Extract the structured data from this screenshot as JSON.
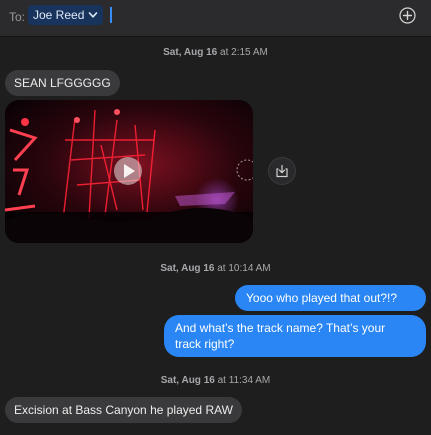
{
  "header": {
    "to_label": "To:",
    "recipient": "Joe Reed",
    "recipient_icon": "chevron-down-icon",
    "add_icon": "plus-circle-icon"
  },
  "messages": {
    "ts1": {
      "day": "Sat, Aug 16",
      "at": "at",
      "time": "2:15 AM"
    },
    "m1": "SEAN LFGGGGG",
    "video": {
      "play_icon": "play-icon",
      "save_icon": "save-download-icon"
    },
    "ts2": {
      "day": "Sat, Aug 16",
      "at": "at",
      "time": "10:14 AM"
    },
    "m2": "Yooo who played that out?!?",
    "m3_line1": "And what’s the track name? That’s your",
    "m3_line2": "track right?",
    "ts3": {
      "day": "Sat, Aug 16",
      "at": "at",
      "time": "11:34 AM"
    },
    "m4": "Excision at Bass Canyon he played RAW"
  },
  "colors": {
    "background": "#1e1e1e",
    "header": "#2b2b2d",
    "incoming_bubble": "#3a3a3c",
    "outgoing_bubble": "#2a86f4",
    "recipient_token": "#18345c",
    "caret": "#3b8cf5"
  }
}
